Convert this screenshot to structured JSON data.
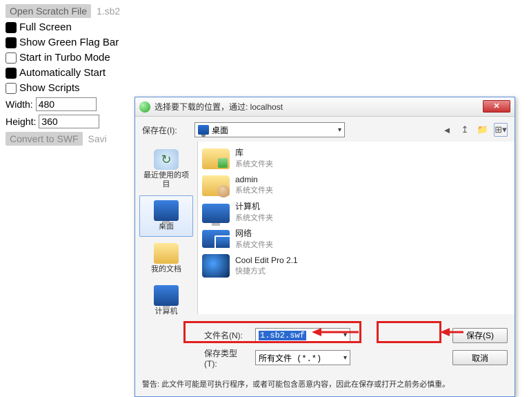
{
  "left": {
    "open_btn": "Open Scratch File",
    "file": "1.sb2",
    "opts": [
      {
        "label": "Full Screen",
        "checked": true
      },
      {
        "label": "Show Green Flag Bar",
        "checked": true
      },
      {
        "label": "Start in Turbo Mode",
        "checked": false
      },
      {
        "label": "Automatically Start",
        "checked": true
      },
      {
        "label": "Show Scripts",
        "checked": false
      }
    ],
    "width_label": "Width:",
    "width_val": "480",
    "height_label": "Height:",
    "height_val": "360",
    "convert_btn": "Convert to SWF",
    "saving": "Savi"
  },
  "dialog": {
    "title": "选择要下载的位置，通过: localhost",
    "save_in_label": "保存在(I):",
    "save_in_value": "桌面",
    "sidebar": [
      {
        "label": "最近使用的项目",
        "icon": "recent"
      },
      {
        "label": "桌面",
        "icon": "desktop",
        "selected": true
      },
      {
        "label": "我的文档",
        "icon": "docs"
      },
      {
        "label": "计算机",
        "icon": "comp"
      }
    ],
    "files": [
      {
        "name": "库",
        "sub": "系统文件夹",
        "icon": "lib"
      },
      {
        "name": "admin",
        "sub": "系统文件夹",
        "icon": "admin"
      },
      {
        "name": "计算机",
        "sub": "系统文件夹",
        "icon": "comp"
      },
      {
        "name": "网络",
        "sub": "系统文件夹",
        "icon": "net"
      },
      {
        "name": "Cool Edit Pro 2.1",
        "sub": "快捷方式",
        "icon": "cool"
      }
    ],
    "filename_label": "文件名(N):",
    "filename_value": "1.sb2.swf",
    "filetype_label": "保存类型(T):",
    "filetype_value": "所有文件 (*.*)",
    "save_btn": "保存(S)",
    "cancel_btn": "取消",
    "warning": "警告: 此文件可能是可执行程序，或者可能包含恶意内容，因此在保存或打开之前务必慎重。"
  }
}
